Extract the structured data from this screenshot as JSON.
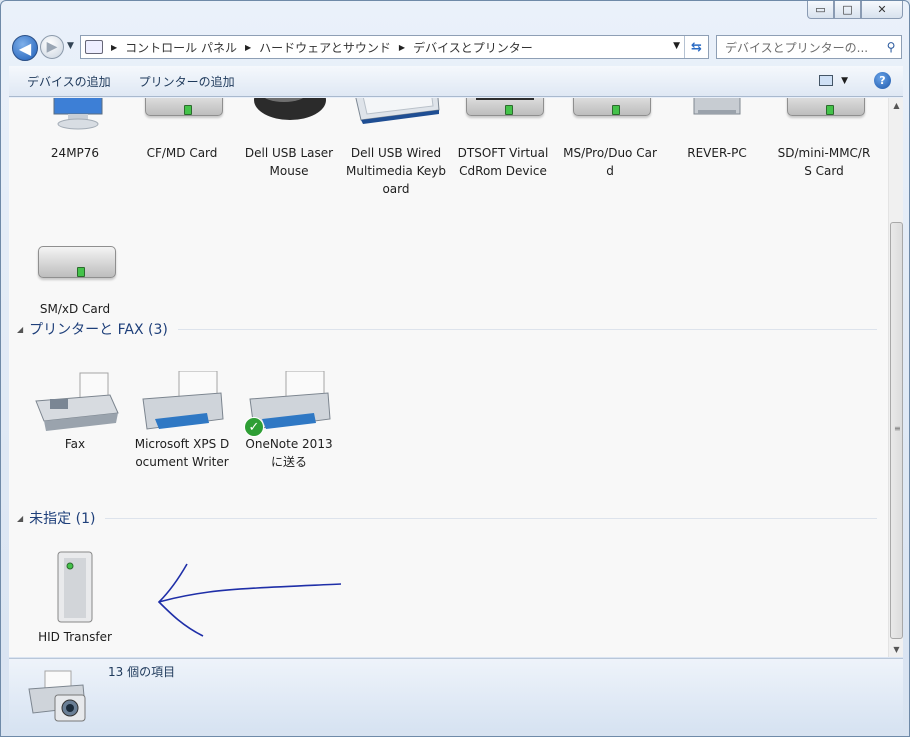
{
  "window": {
    "controls": {
      "minimize": "▭",
      "maximize": "□",
      "close": "✕"
    }
  },
  "nav": {
    "back": "◀",
    "forward": "▶",
    "breadcrumb": [
      "コントロール パネル",
      "ハードウェアとサウンド",
      "デバイスとプリンター"
    ],
    "search_placeholder": "デバイスとプリンターの..."
  },
  "toolbar": {
    "add_device": "デバイスの追加",
    "add_printer": "プリンターの追加"
  },
  "devices": [
    {
      "label": "24MP76",
      "icon": "monitor-icon"
    },
    {
      "label": "CF/MD Card",
      "icon": "drive-icon"
    },
    {
      "label": "Dell USB Laser Mouse",
      "icon": "mouse-icon"
    },
    {
      "label": "Dell USB Wired Multimedia Keyboard",
      "icon": "keyboard-icon"
    },
    {
      "label": "DTSOFT Virtual CdRom Device",
      "icon": "cdrom-icon"
    },
    {
      "label": "MS/Pro/Duo Card",
      "icon": "drive-icon"
    },
    {
      "label": "REVER-PC",
      "icon": "computer-icon"
    },
    {
      "label": "SD/mini-MMC/RS Card",
      "icon": "drive-icon"
    },
    {
      "label": "SM/xD Card",
      "icon": "drive-icon"
    }
  ],
  "printers_group": {
    "title": "プリンターと FAX (3)",
    "items": [
      {
        "label": "Fax",
        "icon": "fax-icon"
      },
      {
        "label": "Microsoft XPS Document Writer",
        "icon": "printer-icon"
      },
      {
        "label": "OneNote 2013 に送る",
        "icon": "printer-icon",
        "default": true
      }
    ]
  },
  "unspecified_group": {
    "title": "未指定 (1)",
    "items": [
      {
        "label": "HID Transfer",
        "icon": "tower-icon"
      }
    ]
  },
  "status": {
    "count_text": "13 個の項目"
  },
  "colors": {
    "annotation_arrow": "#1f2fa8",
    "group_title": "#1e3f7a",
    "status_led": "#44c24a"
  }
}
